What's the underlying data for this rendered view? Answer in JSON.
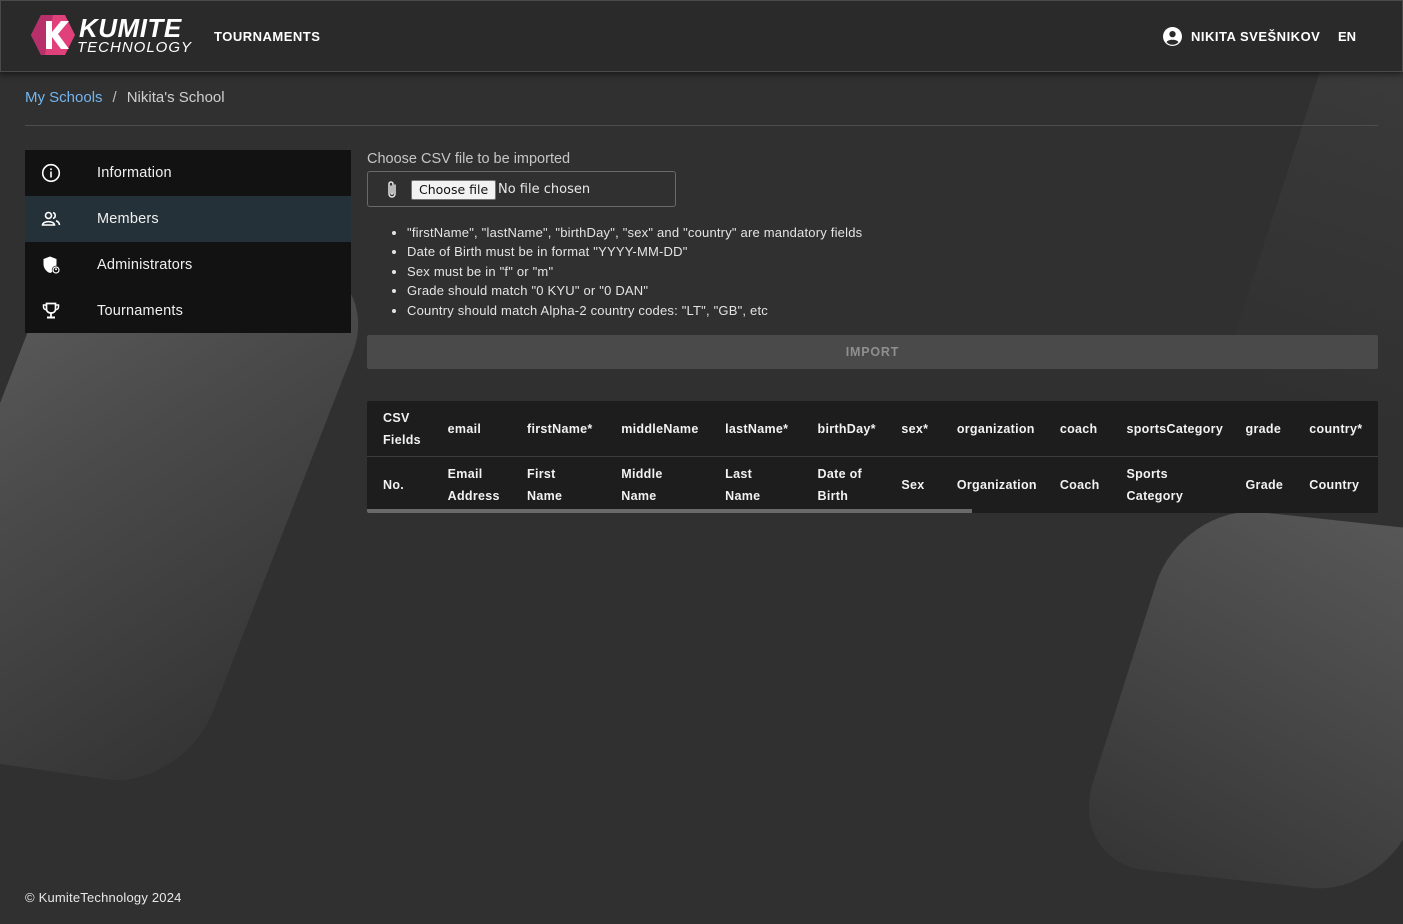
{
  "header": {
    "logo_word1": "KUMITE",
    "logo_word2": "TECHNOLOGY",
    "nav_tournaments": "TOURNAMENTS",
    "user_name": "NIKITA SVEŠNIKOV",
    "language": "EN"
  },
  "breadcrumb": {
    "parent": "My Schools",
    "separator": "/",
    "current": "Nikita's School"
  },
  "sidebar": {
    "items": [
      {
        "label": "Information",
        "icon": "info-icon",
        "active": false
      },
      {
        "label": "Members",
        "icon": "members-icon",
        "active": true
      },
      {
        "label": "Administrators",
        "icon": "admin-shield-icon",
        "active": false
      },
      {
        "label": "Tournaments",
        "icon": "trophy-icon",
        "active": false
      }
    ]
  },
  "import": {
    "label": "Choose CSV file to be imported",
    "choose_button": "Choose file",
    "file_status": "No file chosen",
    "rules": [
      "\"firstName\", \"lastName\", \"birthDay\", \"sex\" and \"country\" are mandatory fields",
      "Date of Birth must be in format \"YYYY-MM-DD\"",
      "Sex must be in \"f\" or \"m\"",
      "Grade should match \"0 KYU\" or \"0 DAN\"",
      "Country should match Alpha-2 country codes: \"LT\", \"GB\", etc"
    ],
    "import_button": "IMPORT"
  },
  "mapping_table": {
    "csv_fields": [
      "CSV Fields",
      "email",
      "firstName*",
      "middleName",
      "lastName*",
      "birthDay*",
      "sex*",
      "organization",
      "coach",
      "sportsCategory",
      "grade",
      "country*"
    ],
    "display_fields": [
      "No.",
      "Email Address",
      "First Name",
      "Middle Name",
      "Last Name",
      "Date of Birth",
      "Sex",
      "Organization",
      "Coach",
      "Sports Category",
      "Grade",
      "Country"
    ]
  },
  "footer": {
    "copyright": "© KumiteTechnology 2024"
  },
  "colors": {
    "link": "#73b5ee",
    "active_nav": "#253139",
    "logo_pink": "#e0417a"
  }
}
